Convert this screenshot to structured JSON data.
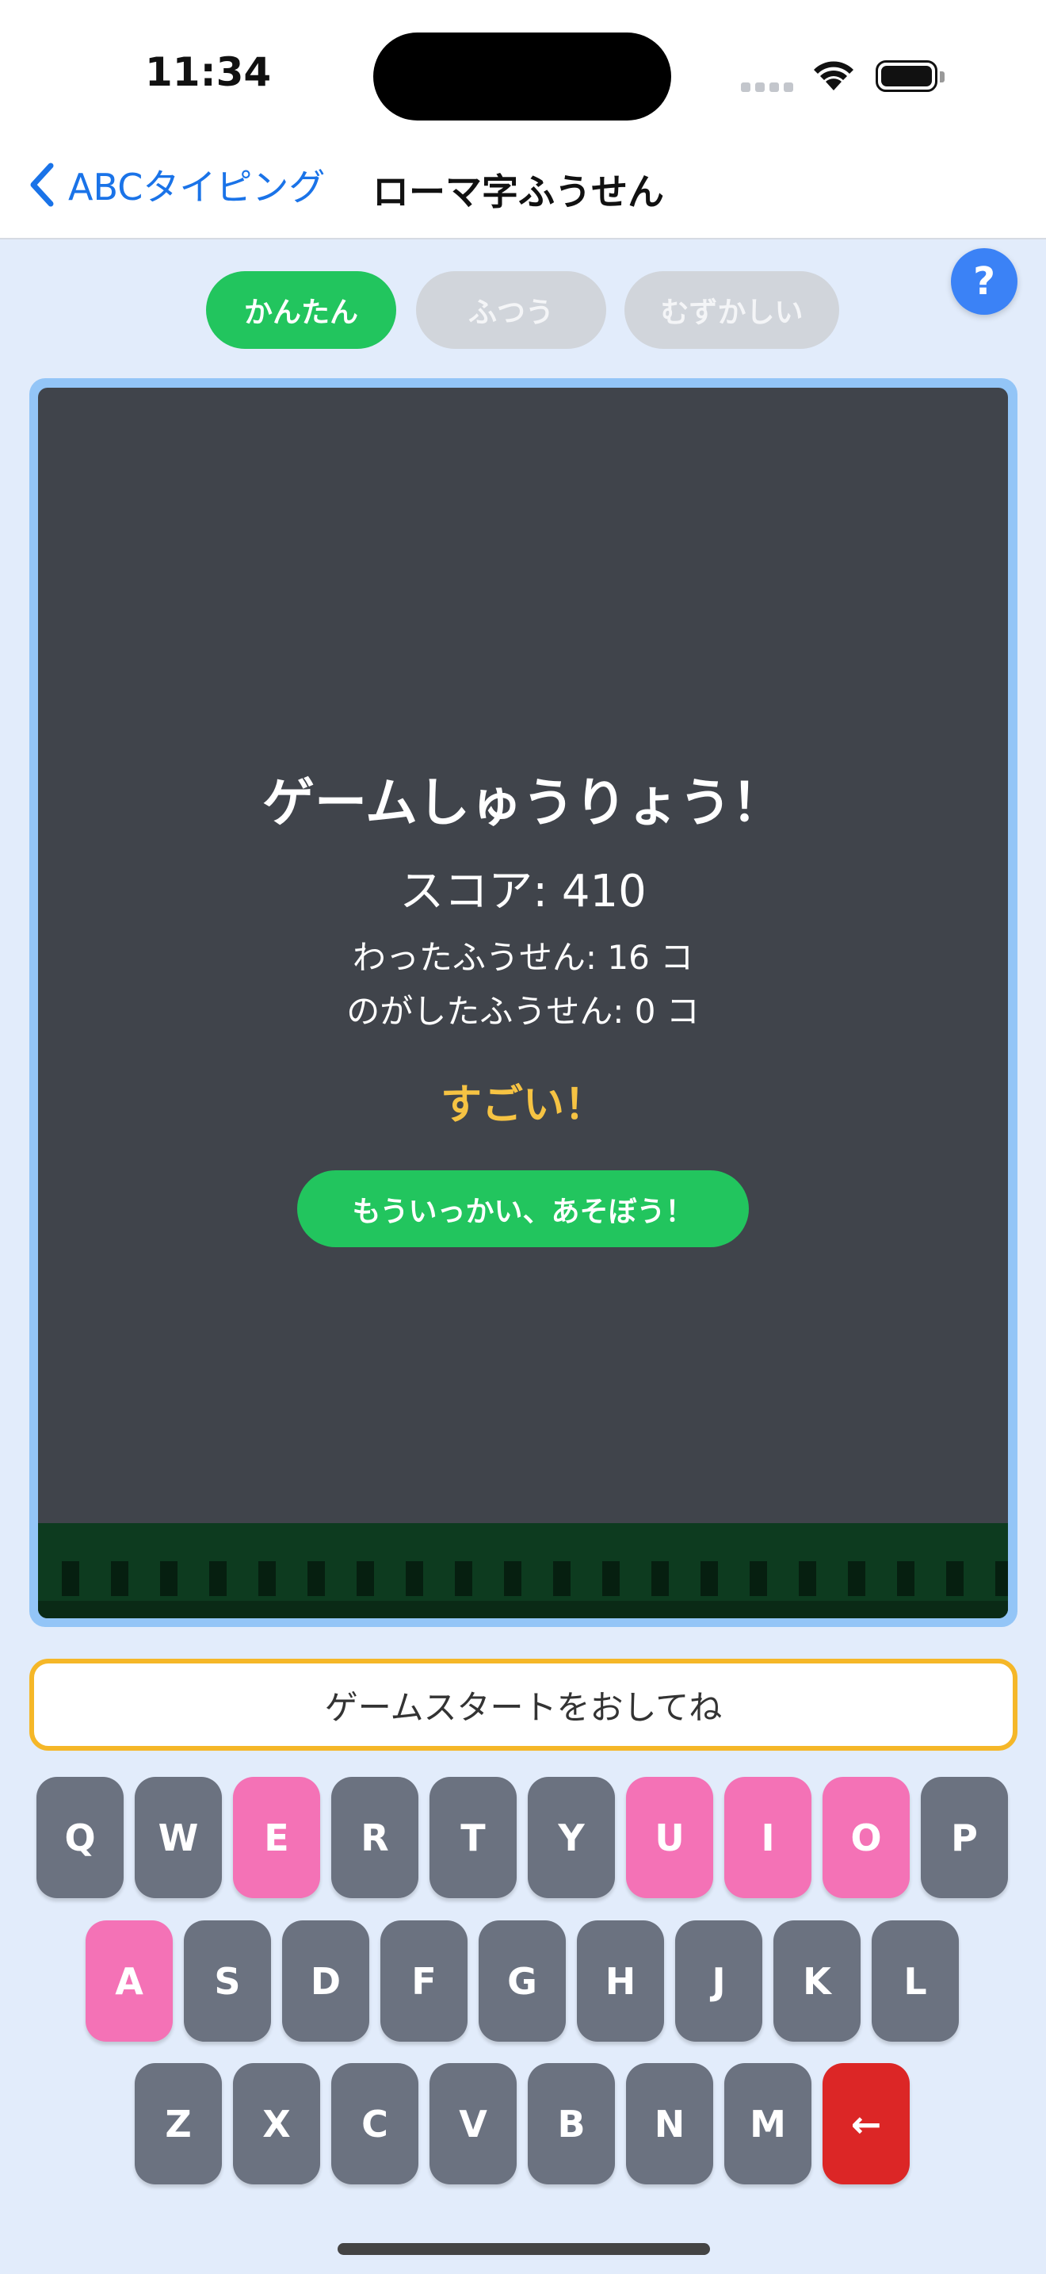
{
  "status_bar": {
    "time": "11:34"
  },
  "nav": {
    "back_label": "ABCタイピング",
    "title": "ローマ字ふうせん"
  },
  "help": {
    "label": "?"
  },
  "difficulty": {
    "selected": "かんたん",
    "options": [
      "かんたん",
      "ふつう",
      "むずかしい"
    ]
  },
  "game_over": {
    "title": "ゲームしゅうりょう！",
    "score": "スコア: 410",
    "popped": "わったふうせん: 16 コ",
    "missed": "のがしたふうせん: 0 コ",
    "praise": "すごい！",
    "replay_label": "もういっかい、あそぼう！"
  },
  "input": {
    "prompt": "ゲームスタートをおしてね"
  },
  "keyboard": {
    "rows": [
      [
        "Q",
        "W",
        "E",
        "R",
        "T",
        "Y",
        "U",
        "I",
        "O",
        "P"
      ],
      [
        "A",
        "S",
        "D",
        "F",
        "G",
        "H",
        "J",
        "K",
        "L"
      ],
      [
        "Z",
        "X",
        "C",
        "V",
        "B",
        "N",
        "M",
        "←"
      ]
    ],
    "highlighted_vowels": [
      "A",
      "E",
      "I",
      "O",
      "U"
    ],
    "backspace": "←"
  },
  "colors": {
    "accent": "#22c55e",
    "vowel_key": "#f472b6",
    "key": "#6b7280",
    "backspace_key": "#dc2626",
    "input_border": "#f5b728",
    "praise": "#f6c343",
    "link": "#1a73e8"
  }
}
